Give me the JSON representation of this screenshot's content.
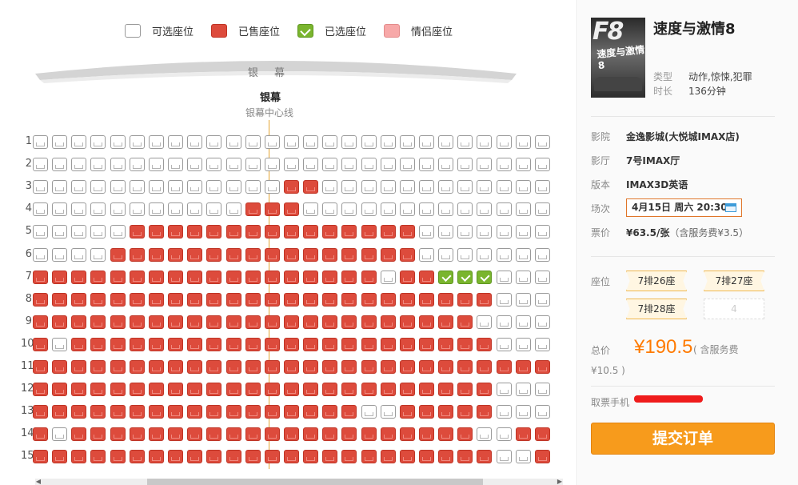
{
  "legend": [
    {
      "label": "可选座位",
      "type": "avail"
    },
    {
      "label": "已售座位",
      "type": "sold"
    },
    {
      "label": "已选座位",
      "type": "sel"
    },
    {
      "label": "情侣座位",
      "type": "couple"
    }
  ],
  "screen": {
    "caption": "银 幕",
    "title": "银幕",
    "centerline_label": "银幕中心线"
  },
  "seat_map": {
    "rows": [
      {
        "num": "1",
        "seats": "AAAAAAAAAAAAAAAAAAAAAAAAAAA"
      },
      {
        "num": "2",
        "seats": "AAAAAAAAAAAAAAAAAAAAAAAAAAA"
      },
      {
        "num": "3",
        "seats": "AAAAAAAAAAAAASSAAAAAAAAAAAA"
      },
      {
        "num": "4",
        "seats": "AAAAAAAAAAASSSAAAAAAAAAAAAA"
      },
      {
        "num": "5",
        "seats": "AAAAASSSSSSSSSSSSSSSAAAAAAA"
      },
      {
        "num": "6",
        "seats": "AAAASSSSSSSSSSSSSSSSAAAAAAA"
      },
      {
        "num": "7",
        "seats": "SSSSSSSSSSSSSSSSSSASSXXXAAA"
      },
      {
        "num": "8",
        "seats": "SSSSSSSSSSSSSSSSSSSSSSSSAAA"
      },
      {
        "num": "9",
        "seats": "SSSSSSSSSSSSSSSSSSSSSSSAAAA"
      },
      {
        "num": "10",
        "seats": "SASSSSSSSSSSSSSSSSSSSSSSAAA"
      },
      {
        "num": "11",
        "seats": "SSSSSSSSSSSSSSSSSSSSSSSSSSS"
      },
      {
        "num": "12",
        "seats": "SSSSSSSSSSSSSSSSSSSSSSSSAAA"
      },
      {
        "num": "13",
        "seats": "SSSSSSSSSSSSSSSSSAASSSSSAAA"
      },
      {
        "num": "14",
        "seats": "SASSSSSSSSSSSSSSSSSSSSSAASS"
      },
      {
        "num": "15",
        "seats": "SSSSSSSSSSSSSSSSSSSSSSSSAAS"
      }
    ]
  },
  "movie": {
    "poster_text": "F8",
    "poster_subtitle": "速度与激情8",
    "title": "速度与激情8",
    "genre_label": "类型",
    "genre": "动作,惊悚,犯罪",
    "duration_label": "时长",
    "duration": "136分钟"
  },
  "order": {
    "cinema_label": "影院",
    "cinema": "金逸影城(大悦城IMAX店)",
    "hall_label": "影厅",
    "hall": "7号IMAX厅",
    "version_label": "版本",
    "version": "IMAX3D英语",
    "showtime_label": "场次",
    "showtime": "4月15日 周六 20:30",
    "price_label": "票价",
    "price": "¥63.5/张",
    "price_note": "（含服务费¥3.5）",
    "seats_label": "座位",
    "seats": [
      "7排26座",
      "7排27座",
      "7排28座",
      "4"
    ],
    "total_label": "总价",
    "total": "¥190.5",
    "total_note": "( 含服务费",
    "total_note_2": "¥10.5 )",
    "phone_label": "取票手机",
    "submit_label": "提交订单"
  },
  "colors": {
    "sold": "#dd4b3c",
    "selected": "#7ab52e",
    "couple": "#f7a8a8",
    "accent": "#f79b1c",
    "price": "#ff7a00"
  }
}
